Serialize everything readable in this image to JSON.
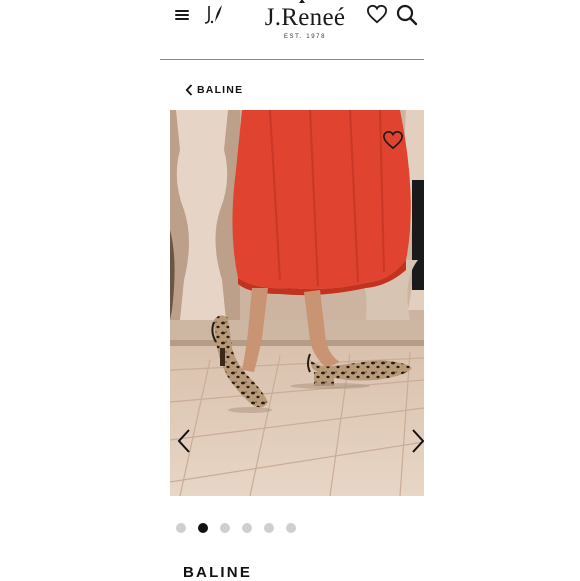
{
  "header": {
    "brand_name": "J.Reneé",
    "brand_tagline": "EST. 1978",
    "icons": [
      "menu-icon",
      "monogram-logo",
      "heart-icon",
      "search-icon"
    ]
  },
  "breadcrumb": {
    "back_label": "BALINE",
    "icon": "chevron-left-icon"
  },
  "gallery": {
    "total_images": 6,
    "active_index": 1,
    "icons": [
      "heart-icon",
      "chevron-left-icon",
      "chevron-right-icon"
    ]
  },
  "product": {
    "title": "BALINE"
  },
  "colors": {
    "accent_dot": "#111111",
    "inactive_dot": "#cfcfcf",
    "skirt": "#e0432f"
  }
}
